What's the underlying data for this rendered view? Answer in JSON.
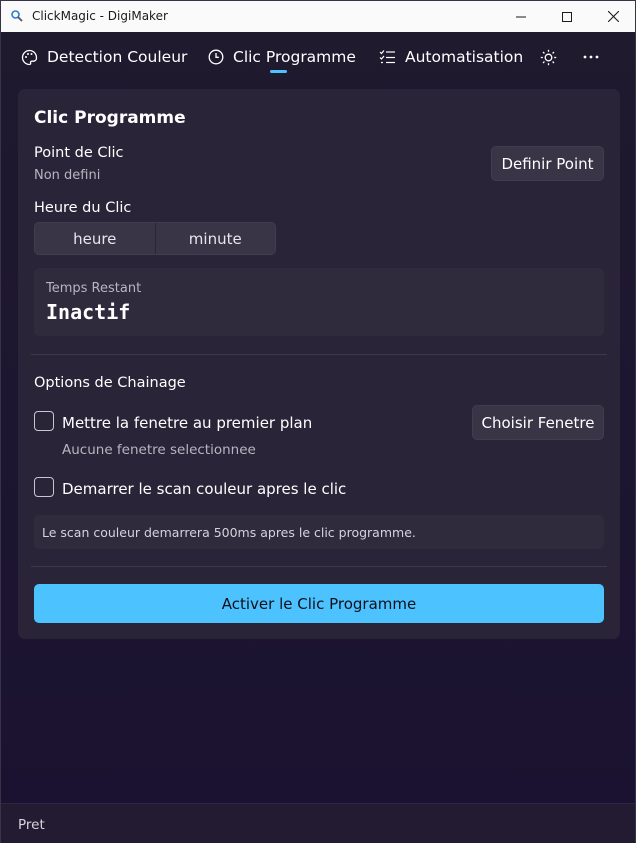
{
  "window": {
    "title": "ClickMagic - DigiMaker"
  },
  "nav": {
    "tabs": [
      {
        "label": "Detection Couleur",
        "icon": "palette-icon"
      },
      {
        "label": "Clic Programme",
        "icon": "clock-icon",
        "selected": true
      },
      {
        "label": "Automatisation",
        "icon": "checklist-icon"
      }
    ],
    "theme_icon": "sun-icon",
    "more_icon": "more-icon"
  },
  "card": {
    "title": "Clic Programme",
    "point": {
      "label": "Point de Clic",
      "value": "Non defini",
      "button": "Definir Point"
    },
    "time": {
      "label": "Heure du Clic",
      "hour_placeholder": "heure",
      "minute_placeholder": "minute"
    },
    "remaining": {
      "label": "Temps Restant",
      "value": "Inactif"
    },
    "chaining": {
      "title": "Options de Chainage",
      "foreground_label": "Mettre la fenetre au premier plan",
      "foreground_checked": false,
      "foreground_sub": "Aucune fenetre selectionnee",
      "choose_window_button": "Choisir Fenetre",
      "scan_label": "Demarrer le scan couleur apres le clic",
      "scan_checked": false,
      "info": "Le scan couleur demarrera 500ms apres le clic programme."
    },
    "activate_button": "Activer le Clic Programme"
  },
  "status": {
    "text": "Pret"
  },
  "colors": {
    "accent": "#4cc2ff",
    "card": "#2a2438",
    "background": "#1d1630"
  }
}
